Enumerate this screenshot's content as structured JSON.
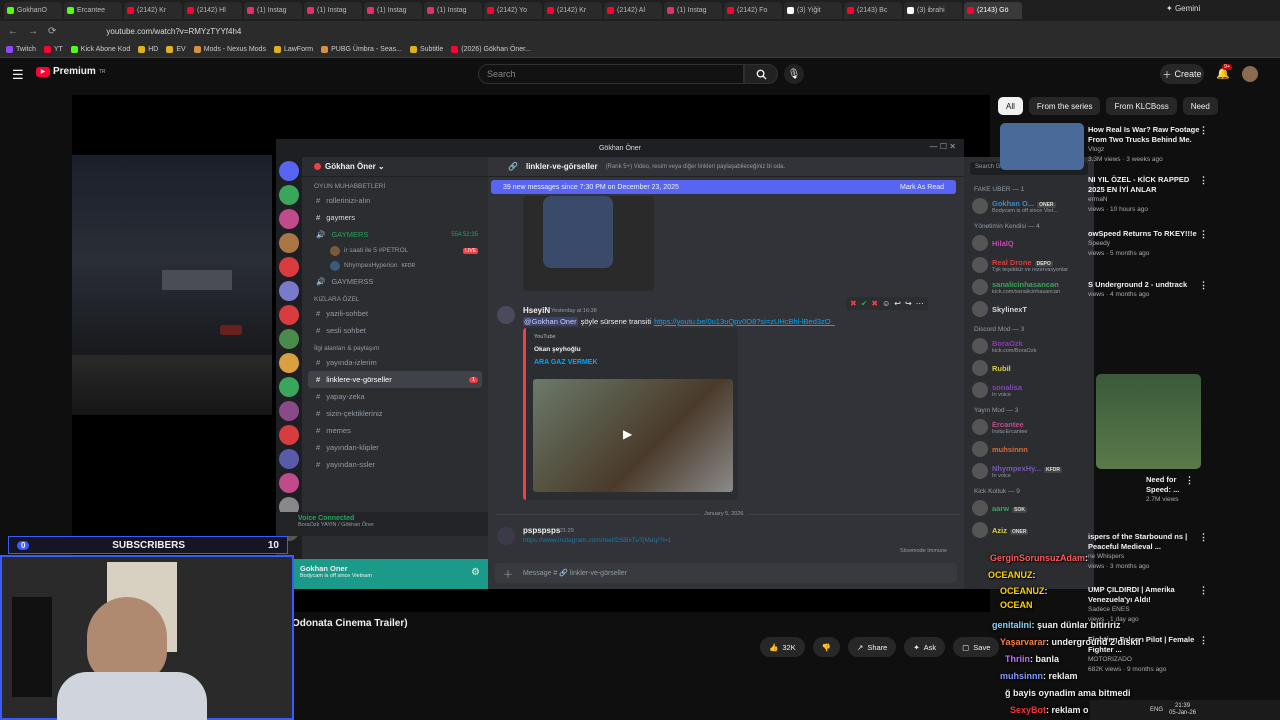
{
  "browser": {
    "tabs": [
      {
        "label": "GokhanO",
        "color": "#53fc18"
      },
      {
        "label": "Ercantee",
        "color": "#53fc18"
      },
      {
        "label": "(2142) Kr",
        "color": "#ff0033"
      },
      {
        "label": "(2142) Hl",
        "color": "#ff0033"
      },
      {
        "label": "(1) Instag",
        "color": "#e1306c"
      },
      {
        "label": "(1) Instag",
        "color": "#e1306c"
      },
      {
        "label": "(1) Instag",
        "color": "#e1306c"
      },
      {
        "label": "(1) Instag",
        "color": "#e1306c"
      },
      {
        "label": "(2142) Yo",
        "color": "#ff0033"
      },
      {
        "label": "(2142) Kr",
        "color": "#ff0033"
      },
      {
        "label": "(2142) Al",
        "color": "#ff0033"
      },
      {
        "label": "(1) Instag",
        "color": "#e1306c"
      },
      {
        "label": "(2142) Fo",
        "color": "#ff0033"
      },
      {
        "label": "(3) Yiğit",
        "color": "#ffffff"
      },
      {
        "label": "(2143) Bc",
        "color": "#ff0033"
      },
      {
        "label": "(3) ibrahi",
        "color": "#ffffff"
      },
      {
        "label": "(2143) Gö",
        "color": "#ff0033"
      }
    ],
    "gemini_label": "Gemini",
    "url": "youtube.com/watch?v=RMYzTYYf4h4",
    "bookmarks": [
      {
        "label": "Twitch",
        "color": "#9146ff"
      },
      {
        "label": "YT",
        "color": "#ff0033"
      },
      {
        "label": "Kick Abone Kod",
        "color": "#53fc18"
      },
      {
        "label": "HD",
        "color": "#e0b020"
      },
      {
        "label": "EV",
        "color": "#e0b020"
      },
      {
        "label": "Mods - Nexus Mods",
        "color": "#d98f40"
      },
      {
        "label": "LawForm",
        "color": "#e0b020"
      },
      {
        "label": "PUBG Ümbra - Seas...",
        "color": "#d98f40"
      },
      {
        "label": "Subtitle",
        "color": "#e0b020"
      },
      {
        "label": "(2026) Gökhan Öner...",
        "color": "#ff0033"
      }
    ]
  },
  "youtube": {
    "logo": "Premium",
    "logo_sup": "TR",
    "search_placeholder": "Search",
    "create_label": "Create",
    "notif_count": "9+",
    "video_title": "Odonata Cinema Trailer)",
    "actions": {
      "likes": "32K",
      "share": "Share",
      "ask": "Ask",
      "save": "Save"
    },
    "chips": [
      "All",
      "From the series",
      "From KLCBoss",
      "Need"
    ],
    "recommendations": [
      {
        "title": "How Real Is War? Raw Footage From Two Trucks Behind Me.",
        "channel": "Vlogz",
        "meta": "3.3M views · 3 weeks ago"
      },
      {
        "title": "NI YIL ÖZEL - KİCK RAPPED 2025 EN İYİ ANLAR",
        "channel": "ermaN",
        "meta": "views · 10 hours ago"
      },
      {
        "title": "owSpeed Returns To RKEY!!!e",
        "channel": "Speedy",
        "meta": "views · 5 months ago"
      },
      {
        "title": "S Underground 2 - undtrack",
        "channel": "",
        "meta": "views · 4 months ago"
      },
      {
        "title": "Need for Speed: ...",
        "channel": "",
        "meta": "2.7M views"
      },
      {
        "title": "ispers of the Starbound ns | Peaceful Medieval ...",
        "channel": "ne Whispers",
        "meta": "views · 3 months ago"
      },
      {
        "title": "UMP ÇILDIRDI | Amerika Venezuela'yı Aldı!",
        "channel": "Sadece ENES",
        "meta": "views · 1 day ago"
      },
      {
        "title": "Fighting Falcon Pilot | Female Fighter ...",
        "channel": "MOTORIZADO",
        "meta": "682K views · 9 months ago"
      }
    ]
  },
  "discord": {
    "window_title": "Gökhan Öner",
    "server_name": "Gökhan Öner",
    "categories": {
      "oyun": "OYUN MUHABBETLERİ",
      "kizlara": "KIZLARA ÖZEL",
      "ilgi": "İlgi alanları & paylaşım"
    },
    "channels_top": [
      "rollerinizi-alın",
      "gaymers"
    ],
    "voice_channel": "GAYMERS",
    "voice_time": "554:52:35",
    "voice_users": [
      {
        "name": "ir saati ile 5 #PETROL",
        "badge": "LIVE"
      },
      {
        "name": "NhympexHyperion",
        "badge": "KFDR"
      }
    ],
    "channel_gaymerss": "GAYMERSS",
    "channels_kiz": [
      "yazili-sohbet",
      "sesli sohbet"
    ],
    "channels_ilgi": [
      "yayında-izlerim",
      "linklere-ve-görseller",
      "yapay-zeka",
      "sizin-çektikleriniz",
      "memes",
      "yayından-klipler",
      "yayından-ssler"
    ],
    "unread_count": "1",
    "voice_connected": "Voice Connected",
    "voice_path": "BoraOzk YAYIN / Gökhan Öner",
    "user_name": "Gokhan Oner",
    "user_status": "Bodycam is off since Vietnam",
    "chat_channel": "linkler-ve-görseller",
    "chat_topic": "(Rank 5+) Video, resim veya diğer linkleri paylaşabileceğiniz bi oda.",
    "new_messages": "39 new messages since 7:30 PM on December 23, 2025",
    "mark_as_read": "Mark As Read",
    "message": {
      "author": "HseyiN",
      "time": "Yesterday at 16:38",
      "mention": "@Gokhan Oner",
      "text": "şöyle sürsene transiti",
      "link": "https://youtu.be/0u13uQpv0O8?si=zUHcBhl-lBed3zO_",
      "embed_source": "YouTube",
      "embed_author": "Okan şeyhoğlu",
      "embed_title": "ARA GAZ VERMEK"
    },
    "date_divider": "January 5, 2026",
    "message2": {
      "author": "pspspsps",
      "time": "21:29",
      "link": "https://www.instagram.com/reel/DSBxTuTjMaq/?i=1"
    },
    "slowmode": "Slowmode Immune",
    "input_placeholder": "Message # 🔗 linkler-ve-görseller",
    "members_search": "Search Gökhan Öner",
    "member_groups": [
      {
        "title": "FAKE UBER — 1",
        "members": [
          {
            "name": "Gokhan O...",
            "tag": "ONER",
            "sub": "Bodycam is off since Viet..."
          }
        ]
      },
      {
        "title": "Yönetimin Kendisi — 4",
        "members": [
          {
            "name": "HilalQ",
            "tag": "",
            "sub": ""
          },
          {
            "name": "Real Drone",
            "tag": "DEPO",
            "sub": "Tşk teşekkür ve rezervasyonlar"
          },
          {
            "name": "sanalicinhasancan",
            "tag": "",
            "sub": "kick.com/sanalicinhasancan"
          },
          {
            "name": "SkylinexT",
            "tag": "",
            "sub": ""
          }
        ]
      },
      {
        "title": "Discord Mod — 3",
        "members": [
          {
            "name": "BoraOzk",
            "tag": "",
            "sub": "kick.com/BoraOzk"
          },
          {
            "name": "Rubil",
            "tag": "",
            "sub": ""
          },
          {
            "name": "sonalisa",
            "tag": "",
            "sub": "In voice"
          }
        ]
      },
      {
        "title": "Yayın Mod — 3",
        "members": [
          {
            "name": "Ercantee",
            "tag": "",
            "sub": "Insta:Ercantee"
          },
          {
            "name": "muhsinnn",
            "tag": "",
            "sub": ""
          },
          {
            "name": "NhympexHy...",
            "tag": "KFDR",
            "sub": "In voice"
          }
        ]
      },
      {
        "title": "Kick Koltuk — 9",
        "members": [
          {
            "name": "aarw",
            "tag": "SOK",
            "sub": ""
          },
          {
            "name": "Aziz",
            "tag": "ONER",
            "sub": ""
          }
        ]
      }
    ]
  },
  "stream_overlay": {
    "sub_current": "0",
    "sub_label": "SUBSCRIBERS",
    "sub_goal": "10",
    "chat": [
      {
        "user": "GerginSorunsuzAdam",
        "msg": ":",
        "color": "#ff5a5a"
      },
      {
        "user": "OCEANUZ",
        "msg": ":",
        "color": "#ffd400"
      },
      {
        "user": "OCEANUZ",
        "msg": ":",
        "color": "#ffd400"
      },
      {
        "user": "OCEAN",
        "msg": "",
        "color": "#ffd400"
      },
      {
        "user": "genitalini",
        "msg": ": şuan dünlar bitiririz",
        "color": "#7fd7ff"
      },
      {
        "user": "Yaşarvarar",
        "msg": ": underground 2 diskil",
        "color": "#ff7f3f"
      },
      {
        "user": "Thriin",
        "msg": ": banla",
        "color": "#c070ff"
      },
      {
        "user": "muhsinnn",
        "msg": ": reklam",
        "color": "#7f9bff"
      },
      {
        "user": "",
        "msg": "ğ bayis oynadim ama bitmedi",
        "color": "#ff5a5a"
      },
      {
        "user": "SexyBot",
        "msg": ": reklam o",
        "color": "#ff3030"
      }
    ]
  },
  "taskbar": {
    "lang": "ENG",
    "time": "21:39",
    "date": "05-Jan-26"
  }
}
